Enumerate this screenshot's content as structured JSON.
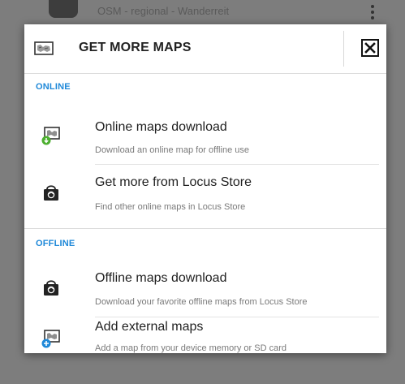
{
  "background": {
    "row_text": "OSM - regional - Wanderreit"
  },
  "dialog": {
    "title": "GET MORE MAPS",
    "header_icon": "map-icon",
    "close_icon": "close-icon"
  },
  "sections": [
    {
      "header": "ONLINE",
      "items": [
        {
          "title": "Online maps download",
          "subtitle": "Download an online map for offline use",
          "icon": "map-download-icon"
        },
        {
          "title": "Get more from Locus Store",
          "subtitle": "Find other online maps in Locus Store",
          "icon": "store-bag-icon"
        }
      ]
    },
    {
      "header": "OFFLINE",
      "items": [
        {
          "title": "Offline maps download",
          "subtitle": "Download your favorite offline maps from Locus Store",
          "icon": "store-bag-icon"
        },
        {
          "title": "Add external maps",
          "subtitle": "Add a map from your device memory or SD card",
          "icon": "map-add-icon"
        }
      ]
    }
  ],
  "colors": {
    "accent": "#1e88d8",
    "overlay": "#7d7d7d",
    "dialog_bg": "#ffffff"
  }
}
